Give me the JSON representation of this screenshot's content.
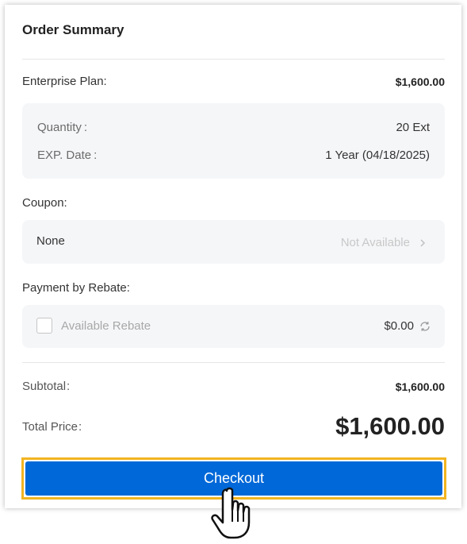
{
  "summary": {
    "title": "Order Summary",
    "plan_label": "Enterprise Plan:",
    "plan_price": "$1,600.00",
    "details": [
      {
        "label": "Quantity",
        "value": "20 Ext"
      },
      {
        "label": "EXP. Date",
        "value": "1 Year (04/18/2025)"
      }
    ],
    "coupon_label": "Coupon:",
    "coupon_value": "None",
    "coupon_status": "Not Available",
    "rebate_label": "Payment by Rebate:",
    "rebate_option": "Available Rebate",
    "rebate_amount": "$0.00",
    "subtotal_label": "Subtotal",
    "subtotal_value": "$1,600.00",
    "total_label": "Total Price",
    "total_value": "$1,600.00",
    "checkout_label": "Checkout"
  },
  "icons": {
    "coupon_arrow": "chevron-right-icon",
    "rebate_refresh": "refresh-icon",
    "cursor": "hand-pointer-icon"
  },
  "colors": {
    "accent": "#0068d8",
    "highlight": "#f2b420",
    "panel": "#f5f6f8"
  }
}
